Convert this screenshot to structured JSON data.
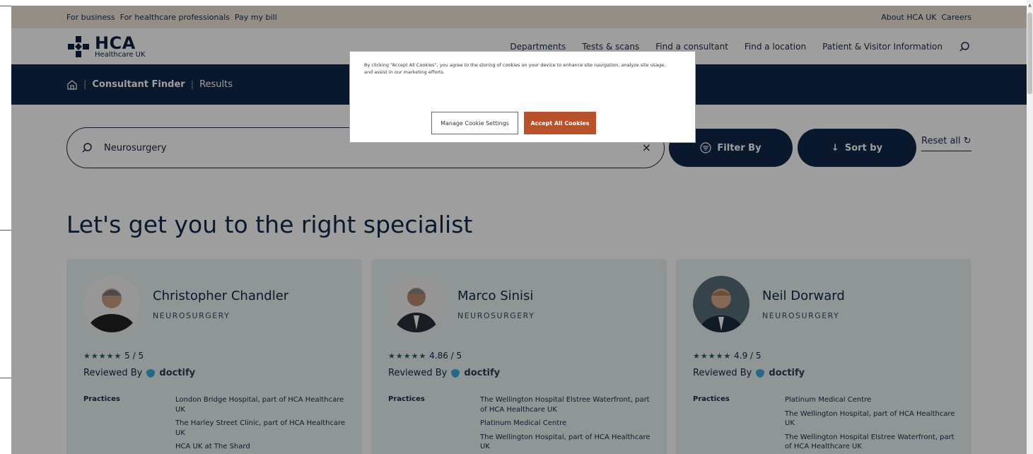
{
  "utility": {
    "left_links": [
      "For business",
      "For healthcare professionals",
      "Pay my bill"
    ],
    "right_links": [
      "About HCA UK",
      "Careers"
    ]
  },
  "logo": {
    "name": "HCA",
    "subtitle": "Healthcare UK"
  },
  "nav": {
    "links": [
      "Departments",
      "Tests & scans",
      "Find a consultant",
      "Find a location",
      "Patient & Visitor Information"
    ]
  },
  "breadcrumb": {
    "current": "Consultant Finder",
    "last": "Results"
  },
  "search": {
    "value": "Neurosurgery",
    "clear": "×"
  },
  "filter_label": "Filter By",
  "sort_label": "Sort by",
  "reset_label": "Reset all",
  "heading": "Let's get you to the right specialist",
  "cookie": {
    "text": "By clicking “Accept All Cookies”, you agree to the storing of cookies on your device to enhance site navigation, analyze site usage, and assist in our marketing efforts.",
    "manage": "Manage Cookie Settings",
    "accept": "Accept All Cookies"
  },
  "reviewed_by": "Reviewed By",
  "doctify": "doctify",
  "practices_label": "Practices",
  "consultants": [
    {
      "name": "Christopher Chandler",
      "specialty": "NEUROSURGERY",
      "rating": "5 / 5",
      "practices": [
        "London Bridge Hospital, part of HCA Healthcare UK",
        "The Harley Street Clinic, part of HCA Healthcare UK",
        "HCA UK at The Shard"
      ]
    },
    {
      "name": "Marco Sinisi",
      "specialty": "NEUROSURGERY",
      "rating": "4.86 / 5",
      "practices": [
        "The Wellington Hospital Elstree Waterfront, part of HCA Healthcare UK",
        "Platinum Medical Centre",
        "The Wellington Hospital, part of HCA Healthcare UK"
      ]
    },
    {
      "name": "Neil Dorward",
      "specialty": "NEUROSURGERY",
      "rating": "4.9 / 5",
      "practices": [
        "Platinum Medical Centre",
        "The Wellington Hospital, part of HCA Healthcare UK",
        "The Wellington Hospital Elstree Waterfront, part of HCA Healthcare UK"
      ]
    }
  ],
  "colors": {
    "navy": "#0f2847",
    "accept": "#b9512b",
    "utility_bg": "#efe6d8",
    "card_bg": "#e9f1f2"
  }
}
